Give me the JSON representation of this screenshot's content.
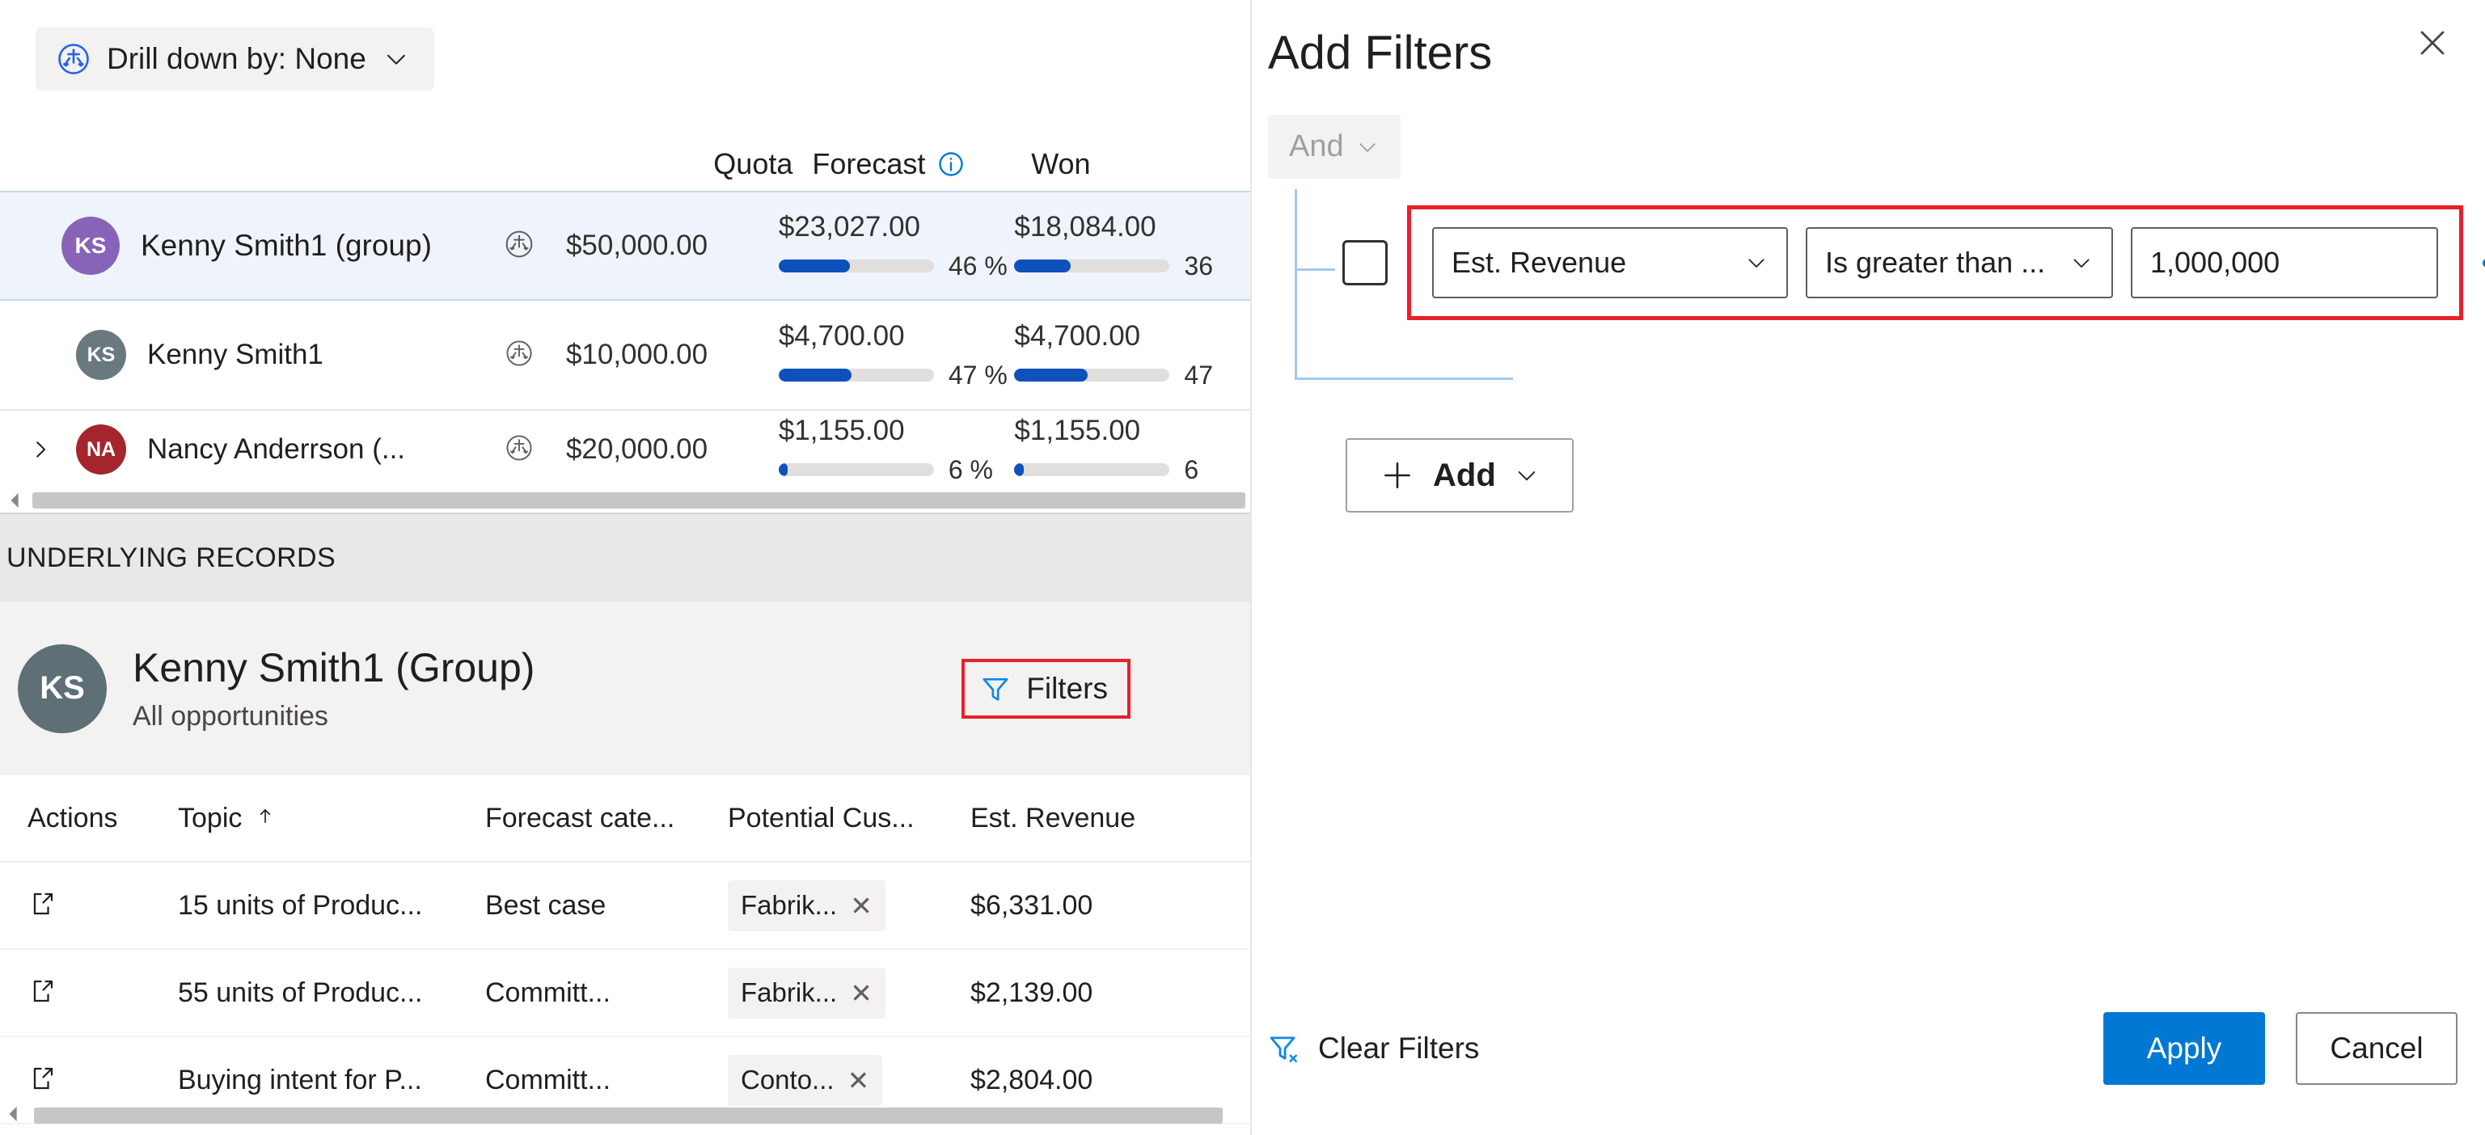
{
  "left": {
    "drilldown": {
      "label": "Drill down by: None",
      "icon": "drill-down-icon",
      "chevron": "chevron-down-icon"
    },
    "forecast_grid": {
      "columns": [
        "",
        "",
        "Quota",
        "Forecast",
        "Won"
      ],
      "forecast_info_icon": "info-icon",
      "rows": [
        {
          "avatar_initials": "KS",
          "avatar_color": "#8764b8",
          "name": "Kenny Smith1 (group)",
          "quota": "$50,000.00",
          "forecast_value": "$23,027.00",
          "forecast_pct": "46 %",
          "forecast_pct_num": 46,
          "won_value": "$18,084.00",
          "won_pct": "36",
          "won_pct_num": 36,
          "selected": true,
          "expandable": false
        },
        {
          "avatar_initials": "KS",
          "avatar_color": "#69797e",
          "name": "Kenny Smith1",
          "quota": "$10,000.00",
          "forecast_value": "$4,700.00",
          "forecast_pct": "47 %",
          "forecast_pct_num": 47,
          "won_value": "$4,700.00",
          "won_pct": "47",
          "won_pct_num": 47,
          "selected": false,
          "expandable": false
        },
        {
          "avatar_initials": "NA",
          "avatar_color": "#a4262c",
          "name": "Nancy Anderrson (...",
          "quota": "$20,000.00",
          "forecast_value": "$1,155.00",
          "forecast_pct": "6 %",
          "forecast_pct_num": 6,
          "won_value": "$1,155.00",
          "won_pct": "6",
          "won_pct_num": 6,
          "selected": false,
          "expandable": true
        }
      ]
    },
    "underlying_records_band": "UNDERLYING RECORDS",
    "record_header": {
      "avatar_initials": "KS",
      "name": "Kenny Smith1 (Group)",
      "subtitle": "All opportunities",
      "filters_button": {
        "label": "Filters",
        "icon": "filter-icon",
        "highlight_color": "#e8202a"
      }
    },
    "records_grid": {
      "columns": [
        "Actions",
        "Topic",
        "Forecast cate...",
        "Potential Cus...",
        "Est. Revenue"
      ],
      "sort_column": "Topic",
      "sort_direction": "ascending",
      "rows": [
        {
          "action_icon": "open-record-icon",
          "topic": "15 units of Produc...",
          "forecast_category": "Best case",
          "potential_customer": "Fabrik...",
          "est_revenue": "$6,331.00"
        },
        {
          "action_icon": "open-record-icon",
          "topic": "55 units of Produc...",
          "forecast_category": "Committ...",
          "potential_customer": "Fabrik...",
          "est_revenue": "$2,139.00"
        },
        {
          "action_icon": "open-record-icon",
          "topic": "Buying intent for P...",
          "forecast_category": "Committ...",
          "potential_customer": "Conto...",
          "est_revenue": "$2,804.00"
        }
      ]
    }
  },
  "right": {
    "title": "Add Filters",
    "close_icon": "close-icon",
    "logic_operator": {
      "value": "And",
      "chevron": "chevron-down-icon"
    },
    "filter_rows": [
      {
        "checkbox_checked": false,
        "field": "Est. Revenue",
        "operator": "Is greater than ...",
        "value": "1,000,000",
        "overflow_icon": "more-options-icon",
        "highlight_color": "#e8202a"
      }
    ],
    "add_button": {
      "label": "Add",
      "plus_icon": "plus-icon",
      "chevron": "chevron-down-icon"
    },
    "footer": {
      "clear_filters": {
        "label": "Clear Filters",
        "icon": "clear-filter-icon"
      },
      "apply": "Apply",
      "cancel": "Cancel"
    }
  },
  "colors": {
    "accent_blue": "#0078d4",
    "bar_blue": "#0f51ba",
    "highlight_red": "#e8202a",
    "selected_row_bg": "#eff4fc"
  }
}
